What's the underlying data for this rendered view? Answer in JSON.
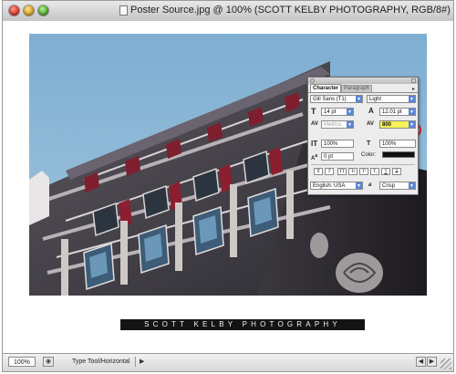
{
  "window": {
    "title": "Poster Source.jpg @ 100% (SCOTT KELBY PHOTOGRAPHY, RGB/8#)",
    "buttons": {
      "close": "close-button",
      "minimize": "minimize-button",
      "zoom": "zoom-button"
    }
  },
  "document": {
    "credit_text": "SCOTT KELBY PHOTOGRAPHY",
    "photo_description_icon": "building-photo"
  },
  "status": {
    "zoom": "100%",
    "info": "Type Tool/Horizontal",
    "arrow_icon": "triangle-right-icon"
  },
  "character_panel": {
    "tabs": [
      "Character",
      "Paragraph"
    ],
    "font_family": "Gill Sans (T1)",
    "font_style": "Light",
    "font_size": "14 pt",
    "leading": "12.01 pt",
    "kerning": "Metrics",
    "tracking": "800",
    "vertical_scale": "100%",
    "horizontal_scale": "100%",
    "baseline_shift": "0 pt",
    "color_label": "Color:",
    "style_buttons": [
      "T",
      "T",
      "TT",
      "Tr",
      "T¹",
      "T,",
      "T",
      "T"
    ],
    "language": "English: USA",
    "antialias_label": "a",
    "antialias": "Crisp"
  },
  "colors": {
    "sky": "#8bb4d3",
    "annotation": "#d81d1d",
    "tracking_highlight": "#f6f25a",
    "text_color_swatch": "#111111"
  }
}
